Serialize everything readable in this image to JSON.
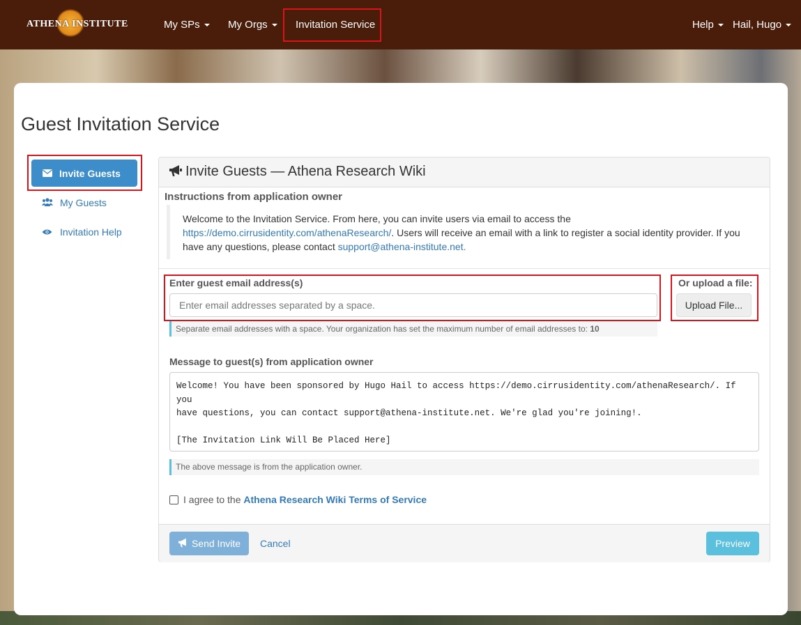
{
  "navbar": {
    "logo_text": "Athena Institute",
    "items": [
      "My SPs",
      "My Orgs",
      "Invitation Service"
    ],
    "right_items": [
      "Help",
      "Hail, Hugo"
    ]
  },
  "page_title": "Guest Invitation Service",
  "sidebar": {
    "active": "Invite Guests",
    "links": [
      "My Guests",
      "Invitation Help"
    ]
  },
  "panel": {
    "title": "Invite Guests — Athena Research Wiki",
    "instructions_title": "Instructions from application owner",
    "instructions_text_1": "Welcome to the Invitation Service. From here, you can invite users via email to access the ",
    "instructions_link": "https://demo.cirrusidentity.com/athenaResearch/",
    "instructions_text_2": ". Users will receive an email with a link to register a social identity provider. If you have any questions, please contact ",
    "instructions_email": "support@athena-institute.net."
  },
  "email": {
    "label": "Enter guest email address(s)",
    "placeholder": "Enter email addresses separated by a space.",
    "help_text": "Separate email addresses with a space. Your organization has set the maximum number of email addresses to: ",
    "max": "10"
  },
  "upload": {
    "label": "Or upload a file:",
    "button": "Upload File..."
  },
  "message": {
    "label": "Message to guest(s) from application owner",
    "body": "Welcome! You have been sponsored by Hugo Hail to access https://demo.cirrusidentity.com/athenaResearch/. If you\nhave questions, you can contact support@athena-institute.net. We're glad you're joining!.\n\n[The Invitation Link Will Be Placed Here]",
    "help_text": "The above message is from the application owner."
  },
  "terms": {
    "prefix": "I agree to the ",
    "link": "Athena Research Wiki Terms of Service"
  },
  "footer": {
    "send": "Send Invite",
    "cancel": "Cancel",
    "preview": "Preview"
  }
}
